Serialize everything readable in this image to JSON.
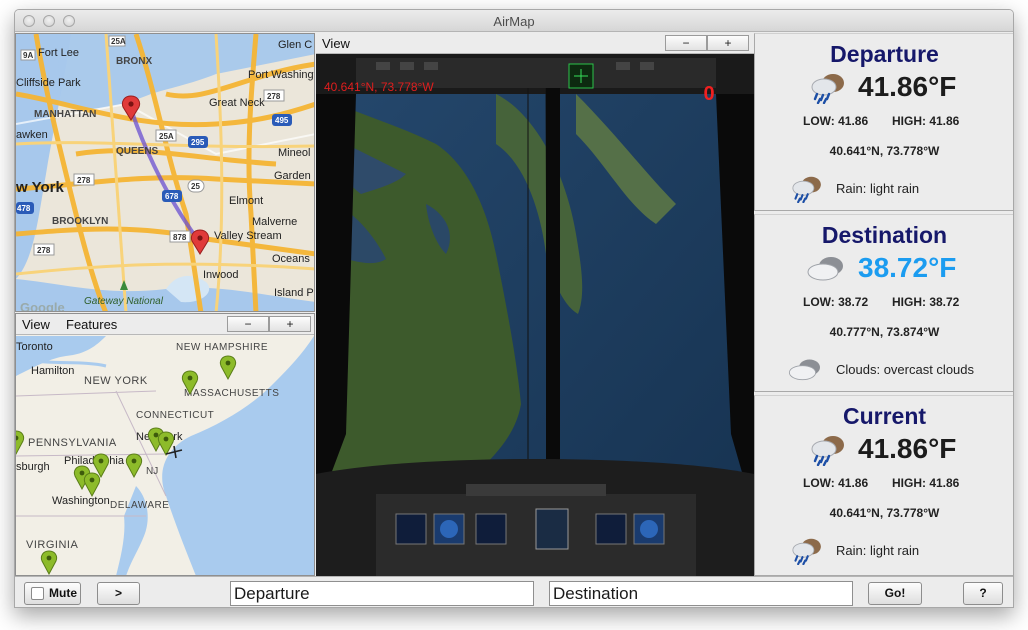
{
  "app": {
    "title": "AirMap"
  },
  "route_map": {
    "labels": {
      "fort_lee": "Fort Lee",
      "bronx": "BRONX",
      "glen_c": "Glen C",
      "cliffside_park": "Cliffside Park",
      "port_washington": "Port\nWashington",
      "manhattan": "MANHATTAN",
      "great_neck": "Great Neck",
      "hawken": "awken",
      "queens": "QUEENS",
      "mineola": "Mineol",
      "new_york": "w York",
      "garden": "Garden",
      "brooklyn": "BROOKLYN",
      "elmont": "Elmont",
      "malverne": "Malverne",
      "valley_stream": "Valley Stream",
      "oceans": "Oceans",
      "inwood": "Inwood",
      "island_park": "Island Par",
      "gateway": "Gateway National",
      "google": "Google",
      "rt_25a_top": "25A",
      "rt_25a": "25A",
      "rt_495": "495",
      "rt_295": "295",
      "rt_278a": "278",
      "rt_278b": "278",
      "rt_25": "25",
      "rt_678": "678",
      "rt_878": "878",
      "rt_9a": "9A",
      "rt_i478": "478",
      "rt_278c": "278"
    }
  },
  "region_map": {
    "toolbar": {
      "view": "View",
      "features": "Features",
      "zoom_out": "−",
      "zoom_in": "+"
    },
    "labels": {
      "toronto": "Toronto",
      "hamilton": "Hamilton",
      "new_york": "NEW YORK",
      "new_hampshire": "NEW\nHAMPSHIRE",
      "massachusetts": "MASSACHUSETTS",
      "connecticut": "CONNECTICUT",
      "pennsylvania": "PENNSYLVANIA",
      "new_york_city": "New York",
      "philadelphia": "Philadelphia",
      "nj": "NJ",
      "pittsburgh": "sburgh",
      "washington": "Washington",
      "delaware": "DELAWARE",
      "virginia": "VIRGINIA"
    }
  },
  "view": {
    "toolbar": {
      "view": "View",
      "zoom_out": "−",
      "zoom_in": "+"
    },
    "coordinates": "40.641°N, 73.778°W",
    "altitude": "0"
  },
  "weather": {
    "departure": {
      "title": "Departure",
      "temp": "41.86°F",
      "low": "LOW: 41.86",
      "high": "HIGH: 41.86",
      "coords": "40.641°N, 73.778°W",
      "icon": "rain-cloud-icon",
      "description": "Rain: light rain"
    },
    "destination": {
      "title": "Destination",
      "temp": "38.72°F",
      "low": "LOW: 38.72",
      "high": "HIGH: 38.72",
      "coords": "40.777°N, 73.874°W",
      "icon": "cloud-icon",
      "description": "Clouds: overcast clouds"
    },
    "current": {
      "title": "Current",
      "temp": "41.86°F",
      "low": "LOW: 41.86",
      "high": "HIGH: 41.86",
      "coords": "40.641°N, 73.778°W",
      "icon": "rain-cloud-icon",
      "description": "Rain: light rain"
    }
  },
  "bottom": {
    "mute_label": "Mute",
    "mute_checked": false,
    "next_label": ">",
    "departure_value": "Departure",
    "destination_value": "Destination",
    "go_label": "Go!",
    "help_label": "?"
  },
  "colors": {
    "title_navy": "#16186a",
    "cool_temp": "#1b9cf0",
    "route_line": "#7b5fd6",
    "marker_red": "#e03a3a",
    "marker_green": "#8dbb2a",
    "readout_red": "#e01e1e"
  }
}
